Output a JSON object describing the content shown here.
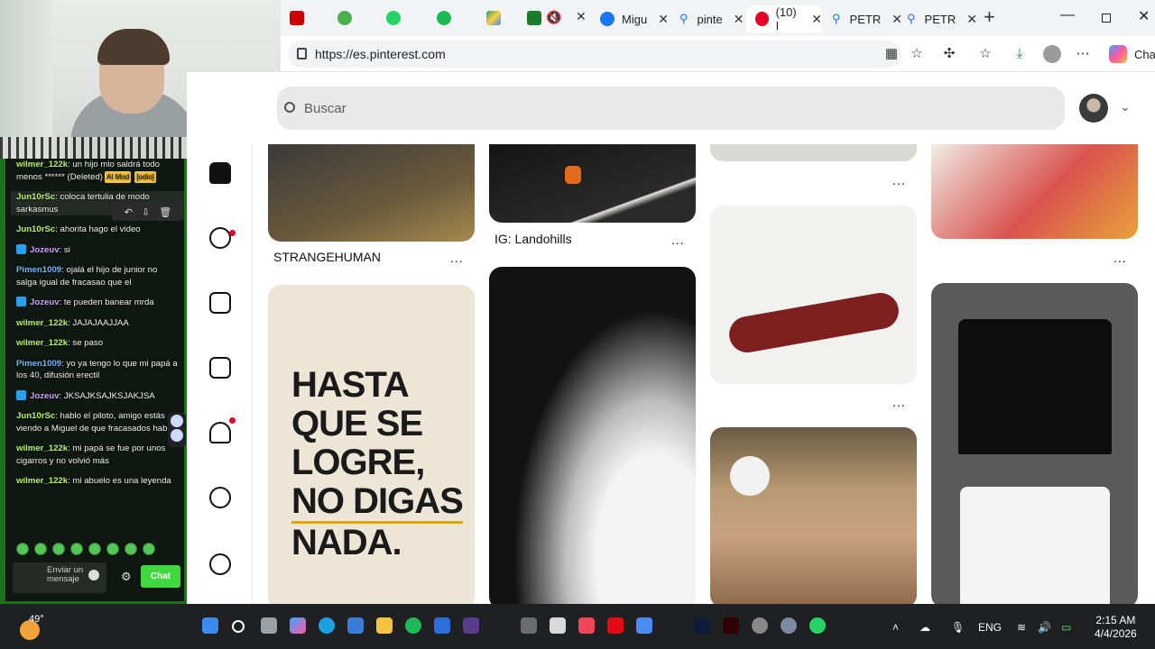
{
  "chat": {
    "messages": [
      {
        "user": "wilmer_122k",
        "text": "un hijo mio saldrá todo menos ****** (Deleted)",
        "tags": [
          "AI Mod",
          "[odio]"
        ],
        "color": "green"
      },
      {
        "user": "Jun10rSc",
        "text": "coloca tertulia de modo sarkasmus",
        "color": "green",
        "hover": true
      },
      {
        "user": "Jun10rSc",
        "text": "ahorita hago el video",
        "color": "green"
      },
      {
        "user": "Jozeuv",
        "text": "si",
        "color": "pink",
        "mod": true
      },
      {
        "user": "Pimen1009",
        "text": "ojalá el hijo de junior no salga igual de fracasao que el",
        "color": "blue"
      },
      {
        "user": "Jozeuv",
        "text": "te pueden banear mrda",
        "color": "pink",
        "mod": true
      },
      {
        "user": "wilmer_122k",
        "text": "JAJAJAAJJAA",
        "color": "green"
      },
      {
        "user": "wilmer_122k",
        "text": "se paso",
        "color": "green"
      },
      {
        "user": "Pimen1009",
        "text": "yo ya tengo lo que mi papá a los 40, difusión erectil",
        "color": "blue"
      },
      {
        "user": "Jozeuv",
        "text": "JKSAJKSAJKSJAKJSA",
        "color": "pink",
        "mod": true
      },
      {
        "user": "Jun10rSc",
        "text": "hablo el piloto, amigo estás viendo a Miguel de que fracasados hablas",
        "color": "green"
      },
      {
        "user": "wilmer_122k",
        "text": "mi papá se fue por unos cigarros y no volvió más",
        "color": "green"
      },
      {
        "user": "wilmer_122k",
        "text": "mi abuelo es una leyenda",
        "color": "green"
      }
    ],
    "input_placeholder": "Enviar un mensaje",
    "send_label": "Chat"
  },
  "browser": {
    "tabs": [
      {
        "label": "Migu",
        "icon": "facebook-icon"
      },
      {
        "label": "pinte",
        "icon": "search-icon"
      },
      {
        "label": "(10) I",
        "icon": "pinterest-icon",
        "active": true
      },
      {
        "label": "PETR",
        "icon": "search-icon"
      },
      {
        "label": "PETR",
        "icon": "search-icon"
      }
    ],
    "url": "https://es.pinterest.com",
    "chat_button": "Chat"
  },
  "pinterest": {
    "search_placeholder": "Buscar",
    "pins": [
      {
        "label": "STRANGEHUMAN"
      },
      {
        "label": "IG: Landohills"
      }
    ],
    "poster_lines": [
      "HASTA",
      "QUE SE",
      "LOGRE,",
      "NO DIGAS",
      "NADA."
    ],
    "more_label": "..."
  },
  "taskbar": {
    "temperature": "49°",
    "language": "ENG",
    "time": "2:15 AM",
    "date": "4/4/2026"
  },
  "colors": {
    "pinterest_red": "#e60023",
    "chat_border": "#1f6f1f",
    "send_button": "#3fd83f"
  }
}
